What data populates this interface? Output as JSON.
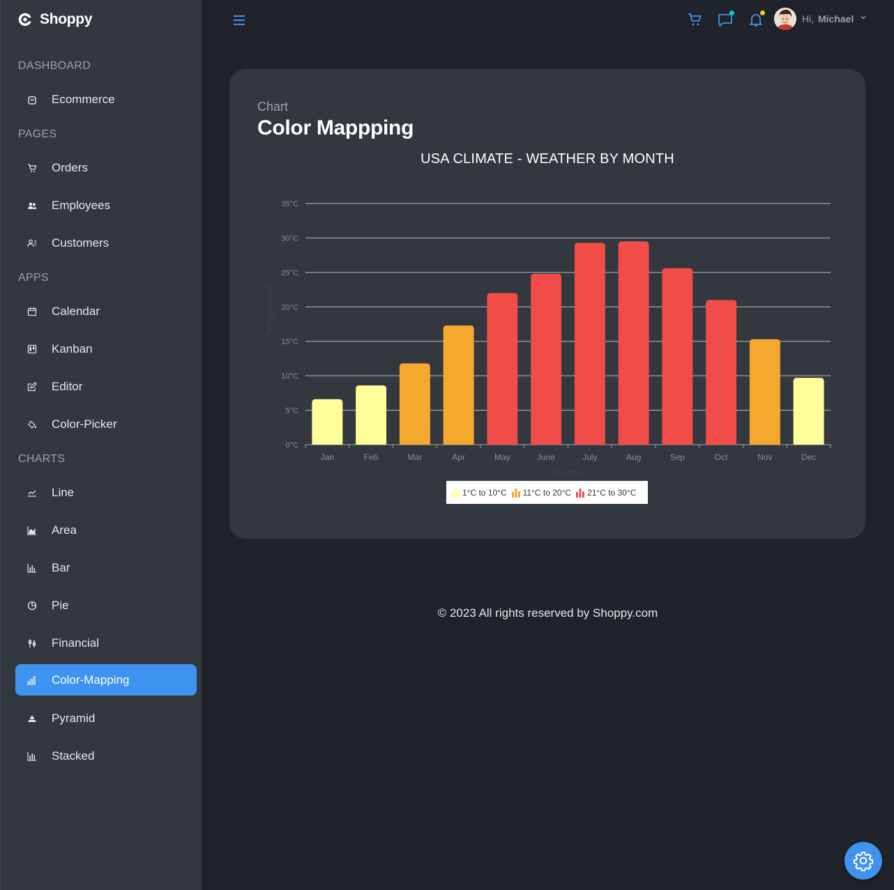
{
  "brand": {
    "name": "Shoppy"
  },
  "sidebar": {
    "sections": [
      {
        "title": "DASHBOARD",
        "items": [
          {
            "label": "Ecommerce",
            "icon": "shopping-bag-icon"
          }
        ]
      },
      {
        "title": "PAGES",
        "items": [
          {
            "label": "Orders",
            "icon": "cart-icon"
          },
          {
            "label": "Employees",
            "icon": "people-icon"
          },
          {
            "label": "Customers",
            "icon": "contacts-icon"
          }
        ]
      },
      {
        "title": "APPS",
        "items": [
          {
            "label": "Calendar",
            "icon": "calendar-icon"
          },
          {
            "label": "Kanban",
            "icon": "kanban-icon"
          },
          {
            "label": "Editor",
            "icon": "edit-icon"
          },
          {
            "label": "Color-Picker",
            "icon": "paint-bucket-icon"
          }
        ]
      },
      {
        "title": "CHARTS",
        "items": [
          {
            "label": "Line",
            "icon": "line-chart-icon"
          },
          {
            "label": "Area",
            "icon": "area-chart-icon"
          },
          {
            "label": "Bar",
            "icon": "bar-chart-icon"
          },
          {
            "label": "Pie",
            "icon": "pie-chart-icon"
          },
          {
            "label": "Financial",
            "icon": "financial-icon"
          },
          {
            "label": "Color-Mapping",
            "icon": "signal-bars-icon",
            "active": true
          },
          {
            "label": "Pyramid",
            "icon": "pyramid-icon"
          },
          {
            "label": "Stacked",
            "icon": "stacked-chart-icon"
          }
        ]
      }
    ]
  },
  "header": {
    "greeting": "Hi,",
    "user_name": "Michael",
    "icons": [
      "menu-icon",
      "cart-icon",
      "chat-icon",
      "bell-icon",
      "chevron-down-icon"
    ],
    "accent": "#3e93ef",
    "chat_dot_color": "#03c9d7",
    "bell_dot_color": "#fec90f"
  },
  "page": {
    "kicker": "Chart",
    "title": "Color Mappping"
  },
  "chart_data": {
    "type": "bar",
    "title": "USA CLIMATE - WEATHER BY MONTH",
    "xlabel": "Months",
    "ylabel": "Temperature",
    "categories": [
      "Jan",
      "Feb",
      "Mar",
      "Apr",
      "May",
      "June",
      "July",
      "Aug",
      "Sep",
      "Oct",
      "Nov",
      "Dec"
    ],
    "values": [
      6.6,
      8.6,
      11.8,
      17.3,
      22,
      24.8,
      29.3,
      29.5,
      25.6,
      21,
      15.3,
      9.7
    ],
    "ylim": [
      0,
      35
    ],
    "yticks": [
      "0°C",
      "5°C",
      "10°C",
      "15°C",
      "20°C",
      "25°C",
      "30°C",
      "35°C"
    ],
    "grid": true,
    "legend_position": "bottom-center",
    "color_ranges": [
      {
        "label": "1°C to 10°C",
        "from": 1,
        "to": 10,
        "color": "#ffff99"
      },
      {
        "label": "11°C to 20°C",
        "from": 11,
        "to": 20,
        "color": "#f5a82e"
      },
      {
        "label": "21°C to 30°C",
        "from": 21,
        "to": 30,
        "color": "#f24c48"
      }
    ]
  },
  "footer": {
    "text": "© 2023 All rights reserved by Shoppy.com"
  },
  "colors": {
    "sidebar_bg": "#33373e",
    "page_bg": "#20232a",
    "card_bg": "#33373e",
    "active_bg": "#3e93ef"
  }
}
